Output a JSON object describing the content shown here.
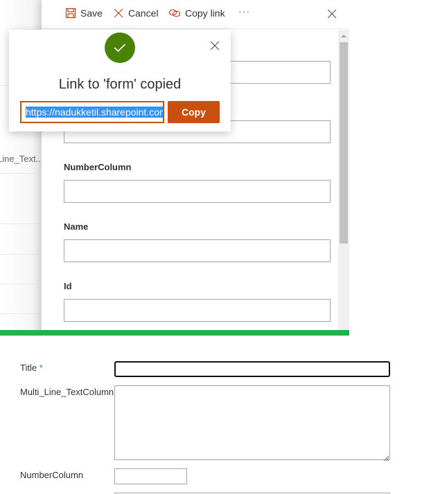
{
  "background_list": {
    "column_header": "Line_Text..."
  },
  "panel": {
    "toolbar": {
      "save_label": "Save",
      "cancel_label": "Cancel",
      "copy_link_label": "Copy link",
      "more_label": "···"
    },
    "fields": [
      {
        "label": "NumberColumn",
        "value": ""
      },
      {
        "label": "Name",
        "value": ""
      },
      {
        "label": "Id",
        "value": ""
      }
    ]
  },
  "dialog": {
    "title": "Link to 'form' copied",
    "url": "https://nadukketil.sharepoint.com",
    "copy_label": "Copy"
  },
  "classic_form": {
    "title_label": "Title",
    "required_marker": " *",
    "multiline_label": "Multi_Line_TextColumn",
    "number_label": "NumberColumn"
  },
  "colors": {
    "accent": "#ca5010",
    "success": "#498205",
    "divider": "#22b14c",
    "selection": "#3390ff"
  }
}
